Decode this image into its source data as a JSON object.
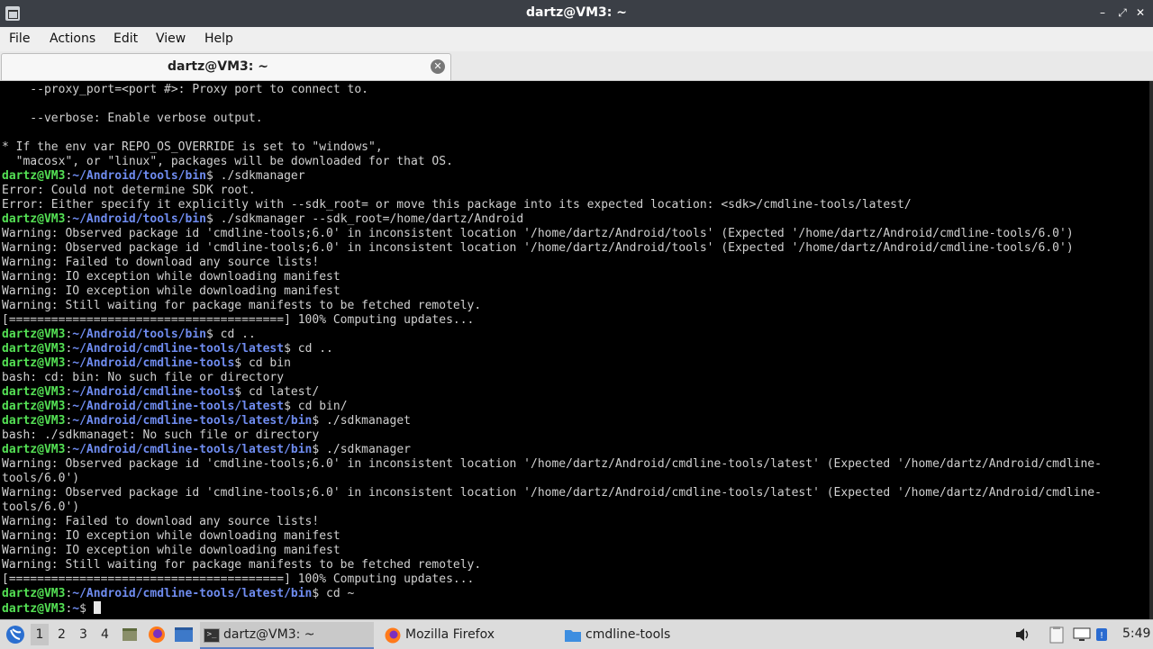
{
  "window": {
    "title": "dartz@VM3: ~",
    "minimize": "–",
    "maximize": "⤢",
    "close": "✕"
  },
  "menu": {
    "file": "File",
    "actions": "Actions",
    "edit": "Edit",
    "view": "View",
    "help": "Help"
  },
  "tab": {
    "label": "dartz@VM3: ~",
    "close": "✕"
  },
  "terminal": {
    "lines": [
      {
        "text": "    --proxy_port=<port #>: Proxy port to connect to."
      },
      {
        "text": ""
      },
      {
        "text": "    --verbose: Enable verbose output."
      },
      {
        "text": ""
      },
      {
        "text": "* If the env var REPO_OS_OVERRIDE is set to \"windows\","
      },
      {
        "text": "  \"macosx\", or \"linux\", packages will be downloaded for that OS."
      },
      {
        "user": "dartz@VM3",
        "path": "~/Android/tools/bin",
        "cmd": "./sdkmanager"
      },
      {
        "text": "Error: Could not determine SDK root."
      },
      {
        "text": "Error: Either specify it explicitly with --sdk_root= or move this package into its expected location: <sdk>/cmdline-tools/latest/"
      },
      {
        "user": "dartz@VM3",
        "path": "~/Android/tools/bin",
        "cmd": "./sdkmanager --sdk_root=/home/dartz/Android"
      },
      {
        "text": "Warning: Observed package id 'cmdline-tools;6.0' in inconsistent location '/home/dartz/Android/tools' (Expected '/home/dartz/Android/cmdline-tools/6.0')"
      },
      {
        "text": "Warning: Observed package id 'cmdline-tools;6.0' in inconsistent location '/home/dartz/Android/tools' (Expected '/home/dartz/Android/cmdline-tools/6.0')"
      },
      {
        "text": "Warning: Failed to download any source lists!"
      },
      {
        "text": "Warning: IO exception while downloading manifest"
      },
      {
        "text": "Warning: IO exception while downloading manifest"
      },
      {
        "text": "Warning: Still waiting for package manifests to be fetched remotely."
      },
      {
        "text": "[=======================================] 100% Computing updates..."
      },
      {
        "user": "dartz@VM3",
        "path": "~/Android/tools/bin",
        "cmd": "cd .."
      },
      {
        "user": "dartz@VM3",
        "path": "~/Android/cmdline-tools/latest",
        "cmd": "cd .."
      },
      {
        "user": "dartz@VM3",
        "path": "~/Android/cmdline-tools",
        "cmd": "cd bin"
      },
      {
        "text": "bash: cd: bin: No such file or directory"
      },
      {
        "user": "dartz@VM3",
        "path": "~/Android/cmdline-tools",
        "cmd": "cd latest/"
      },
      {
        "user": "dartz@VM3",
        "path": "~/Android/cmdline-tools/latest",
        "cmd": "cd bin/"
      },
      {
        "user": "dartz@VM3",
        "path": "~/Android/cmdline-tools/latest/bin",
        "cmd": "./sdkmanaget"
      },
      {
        "text": "bash: ./sdkmanaget: No such file or directory"
      },
      {
        "user": "dartz@VM3",
        "path": "~/Android/cmdline-tools/latest/bin",
        "cmd": "./sdkmanager"
      },
      {
        "text": "Warning: Observed package id 'cmdline-tools;6.0' in inconsistent location '/home/dartz/Android/cmdline-tools/latest' (Expected '/home/dartz/Android/cmdline-"
      },
      {
        "text": "tools/6.0')"
      },
      {
        "text": "Warning: Observed package id 'cmdline-tools;6.0' in inconsistent location '/home/dartz/Android/cmdline-tools/latest' (Expected '/home/dartz/Android/cmdline-"
      },
      {
        "text": "tools/6.0')"
      },
      {
        "text": "Warning: Failed to download any source lists!"
      },
      {
        "text": "Warning: IO exception while downloading manifest"
      },
      {
        "text": "Warning: IO exception while downloading manifest"
      },
      {
        "text": "Warning: Still waiting for package manifests to be fetched remotely."
      },
      {
        "text": "[=======================================] 100% Computing updates..."
      },
      {
        "user": "dartz@VM3",
        "path": "~/Android/cmdline-tools/latest/bin",
        "cmd": "cd ~"
      },
      {
        "user": "dartz@VM3",
        "path": "~",
        "cmd": "",
        "cursor": true
      }
    ]
  },
  "taskbar": {
    "workspaces": [
      "1",
      "2",
      "3",
      "4"
    ],
    "tasks": [
      {
        "label": "dartz@VM3: ~",
        "icon": "terminal-icon"
      },
      {
        "label": "Mozilla Firefox",
        "icon": "firefox-icon"
      },
      {
        "label": "cmdline-tools",
        "icon": "folder-icon"
      }
    ],
    "clock": "5:49"
  },
  "colors": {
    "prompt_user": "#54e054",
    "prompt_path": "#6f8cf0",
    "terminal_bg": "#000000",
    "terminal_fg": "#d0d0d0"
  }
}
